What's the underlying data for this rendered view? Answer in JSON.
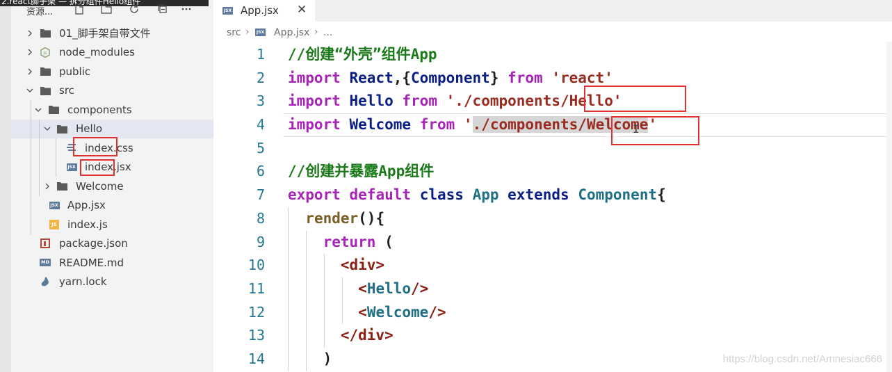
{
  "overlay_title": "2.react脚手架 — 拆分组件Hello组件",
  "sidebar": {
    "explorer_label": "资源...",
    "tree": [
      {
        "label": "01_脚手架自带文件",
        "type": "folder",
        "expanded": false,
        "depth": 0
      },
      {
        "label": "node_modules",
        "type": "node-folder",
        "expanded": false,
        "depth": 0
      },
      {
        "label": "public",
        "type": "folder",
        "expanded": false,
        "depth": 0
      },
      {
        "label": "src",
        "type": "folder",
        "expanded": true,
        "depth": 0
      },
      {
        "label": "components",
        "type": "folder",
        "expanded": true,
        "depth": 1
      },
      {
        "label": "Hello",
        "type": "folder",
        "expanded": true,
        "depth": 2,
        "selected": true
      },
      {
        "label": "index.css",
        "type": "css",
        "depth": 3
      },
      {
        "label": "index.jsx",
        "type": "jsx",
        "depth": 3
      },
      {
        "label": "Welcome",
        "type": "folder",
        "expanded": false,
        "depth": 2
      },
      {
        "label": "App.jsx",
        "type": "jsx",
        "depth": 1
      },
      {
        "label": "index.js",
        "type": "js",
        "depth": 1
      },
      {
        "label": "package.json",
        "type": "pkg",
        "depth": 0
      },
      {
        "label": "README.md",
        "type": "md",
        "depth": 0
      },
      {
        "label": "yarn.lock",
        "type": "yarn",
        "depth": 0
      }
    ]
  },
  "editor": {
    "tab_label": "App.jsx",
    "tab_badge": "JSX",
    "breadcrumb": [
      "src",
      "App.jsx",
      "..."
    ],
    "lines": [
      {
        "n": "1",
        "tokens": [
          [
            "com",
            "//创建“外壳”组件App"
          ]
        ]
      },
      {
        "n": "2",
        "tokens": [
          [
            "kw",
            "import"
          ],
          [
            "pl",
            " "
          ],
          [
            "def",
            "React"
          ],
          [
            "pl",
            ",{"
          ],
          [
            "def",
            "Component"
          ],
          [
            "pl",
            "} "
          ],
          [
            "kw",
            "from"
          ],
          [
            "pl",
            " "
          ],
          [
            "str",
            "'react'"
          ]
        ]
      },
      {
        "n": "3",
        "tokens": [
          [
            "kw",
            "import"
          ],
          [
            "pl",
            " "
          ],
          [
            "def",
            "Hello"
          ],
          [
            "pl",
            " "
          ],
          [
            "kw",
            "from"
          ],
          [
            "pl",
            " "
          ],
          [
            "str",
            "'./components/Hello'"
          ]
        ]
      },
      {
        "n": "4",
        "tokens": [
          [
            "kw",
            "import"
          ],
          [
            "pl",
            " "
          ],
          [
            "def",
            "Welcome"
          ],
          [
            "pl",
            " "
          ],
          [
            "kw",
            "from"
          ],
          [
            "pl",
            " "
          ],
          [
            "str",
            "'"
          ],
          [
            "strsel",
            "./components/Welcome"
          ],
          [
            "str",
            "'"
          ]
        ]
      },
      {
        "n": "5",
        "tokens": []
      },
      {
        "n": "6",
        "tokens": [
          [
            "com",
            "//创建并暴露App组件"
          ]
        ]
      },
      {
        "n": "7",
        "tokens": [
          [
            "kw",
            "export"
          ],
          [
            "pl",
            " "
          ],
          [
            "kw",
            "default"
          ],
          [
            "pl",
            " "
          ],
          [
            "def",
            "class"
          ],
          [
            "pl",
            " "
          ],
          [
            "type",
            "App"
          ],
          [
            "pl",
            " "
          ],
          [
            "def",
            "extends"
          ],
          [
            "pl",
            " "
          ],
          [
            "type",
            "Component"
          ],
          [
            "pl",
            "{"
          ]
        ]
      },
      {
        "n": "8",
        "tokens": [
          [
            "pl",
            "  "
          ],
          [
            "fn",
            "render"
          ],
          [
            "pl",
            "(){"
          ]
        ]
      },
      {
        "n": "9",
        "tokens": [
          [
            "pl",
            "    "
          ],
          [
            "kw",
            "return"
          ],
          [
            "pl",
            " ("
          ]
        ]
      },
      {
        "n": "10",
        "tokens": [
          [
            "pl",
            "      "
          ],
          [
            "tag",
            "<div>"
          ]
        ]
      },
      {
        "n": "11",
        "tokens": [
          [
            "pl",
            "        "
          ],
          [
            "tag",
            "<"
          ],
          [
            "cmp",
            "Hello"
          ],
          [
            "tag",
            "/>"
          ]
        ]
      },
      {
        "n": "12",
        "tokens": [
          [
            "pl",
            "        "
          ],
          [
            "tag",
            "<"
          ],
          [
            "cmp",
            "Welcome"
          ],
          [
            "tag",
            "/>"
          ]
        ]
      },
      {
        "n": "13",
        "tokens": [
          [
            "pl",
            "      "
          ],
          [
            "tag",
            "</div>"
          ]
        ]
      },
      {
        "n": "14",
        "tokens": [
          [
            "pl",
            "    )"
          ]
        ]
      }
    ]
  },
  "watermark": "https://blog.csdn.net/Amnesiac666",
  "colors": {
    "comment": "#1a7a1a",
    "keyword": "#a824b8",
    "identifier": "#0b1e85",
    "type": "#1f6f86",
    "string": "#9a2b20",
    "line_number": "#237893",
    "highlight_box": "#e03030"
  }
}
